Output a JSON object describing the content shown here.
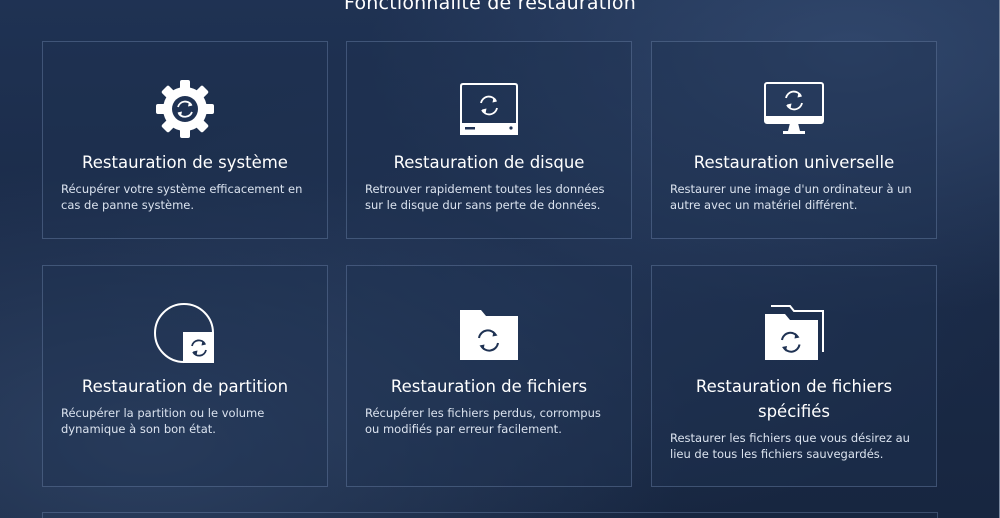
{
  "section": {
    "title": "Fonctionnalité de restauration"
  },
  "cards": [
    {
      "title": "Restauration de système",
      "description": "Récupérer votre système efficacement en cas de panne système.",
      "icon": "gear-restore-icon"
    },
    {
      "title": "Restauration de disque",
      "description": "Retrouver rapidement toutes les données sur le disque dur sans perte de données.",
      "icon": "disk-restore-icon"
    },
    {
      "title": "Restauration universelle",
      "description": "Restaurer une image d'un ordinateur à un autre avec un matériel différent.",
      "icon": "monitor-restore-icon"
    },
    {
      "title": "Restauration de partition",
      "description": "Récupérer la partition ou le volume dynamique à son bon état.",
      "icon": "partition-restore-icon"
    },
    {
      "title": "Restauration de fichiers",
      "description": "Récupérer les fichiers perdus, corrompus ou modifiés par erreur facilement.",
      "icon": "folder-restore-icon"
    },
    {
      "title": "Restauration de fichiers spécifiés",
      "description": "Restaurer les fichiers que vous désirez au lieu de tous les fichiers sauvegardés.",
      "icon": "folders-restore-icon"
    }
  ],
  "colors": {
    "background": "#1a2b48",
    "card_border": "#4f6587",
    "text": "#ffffff",
    "description_text": "#dbe3ef"
  }
}
